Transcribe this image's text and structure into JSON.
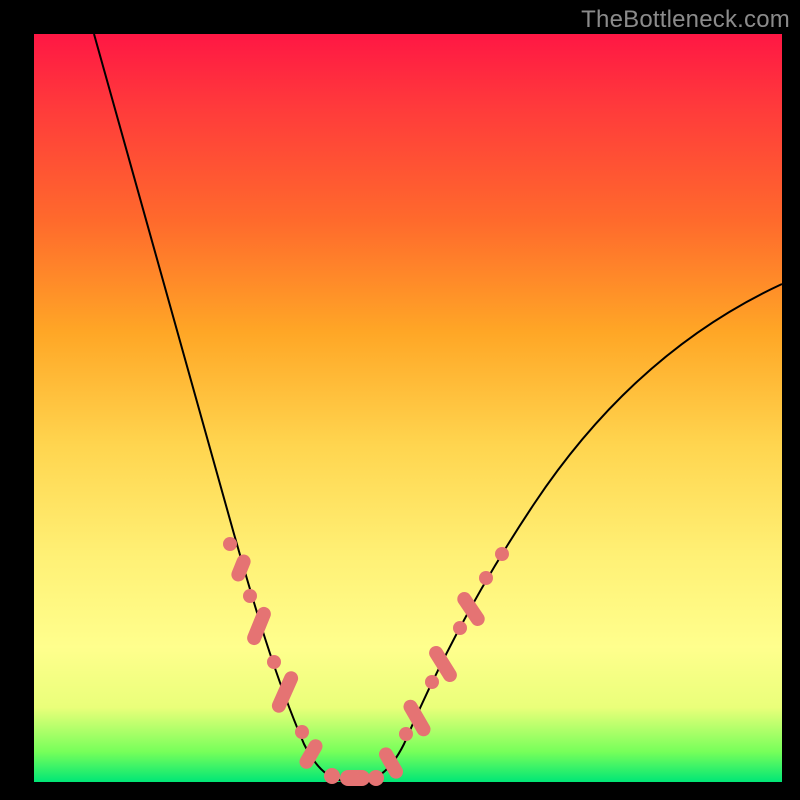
{
  "watermark": "TheBottleneck.com",
  "chart_data": {
    "type": "line",
    "title": "",
    "xlabel": "",
    "ylabel": "",
    "xlim": [
      0,
      100
    ],
    "ylim": [
      0,
      100
    ],
    "background_gradient": [
      "#ff1744",
      "#ff6a2c",
      "#ffd54f",
      "#ffff8d",
      "#00e676"
    ],
    "series": [
      {
        "name": "bottleneck-curve",
        "x": [
          8,
          12,
          16,
          20,
          23,
          26,
          28,
          30,
          32,
          34,
          36,
          38,
          40,
          44,
          48,
          52,
          56,
          60,
          66,
          74,
          82,
          90,
          100
        ],
        "y": [
          100,
          86,
          72,
          58,
          46,
          36,
          28,
          20,
          12,
          6,
          2,
          0,
          0,
          2,
          6,
          12,
          20,
          28,
          38,
          50,
          58,
          64,
          68
        ]
      }
    ],
    "highlight_points": {
      "name": "salmon-dots",
      "x": [
        25,
        26,
        27.5,
        28.5,
        29.5,
        31,
        32,
        33,
        35,
        37,
        38,
        41,
        43,
        44,
        45,
        47,
        48.5,
        50,
        51.5,
        53,
        55,
        57
      ],
      "y": [
        32,
        28,
        25,
        22,
        19,
        14,
        11,
        8,
        4,
        1,
        0,
        0,
        1,
        2,
        4,
        7,
        10,
        13,
        16,
        19,
        23,
        27
      ]
    }
  }
}
